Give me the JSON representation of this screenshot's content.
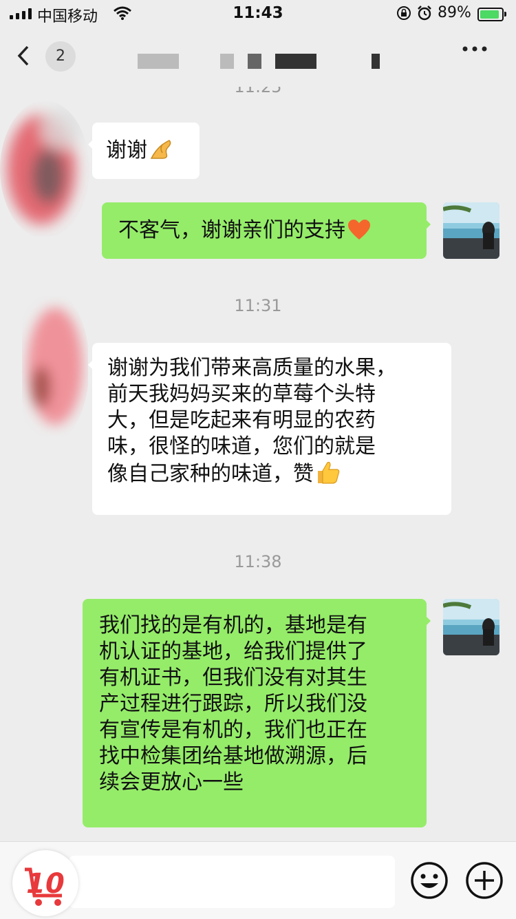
{
  "status_bar": {
    "carrier": "中国移动",
    "time": "11:43",
    "battery_percent": "89%"
  },
  "nav": {
    "back_icon": "chevron-left-icon",
    "unread_count": "2",
    "more_icon": "more-dots-icon"
  },
  "chat": {
    "partial_timestamp": "11:25",
    "msg1": {
      "text": "谢谢",
      "emoji": "ok-hand-emoji"
    },
    "msg2": {
      "text": "不客气，谢谢亲们的支持",
      "emoji": "orange-heart-emoji"
    },
    "timestamp2": "11:31",
    "msg3": {
      "lines": [
        "谢谢为我们带来高质量的水果，",
        "前天我妈妈买来的草莓个头特",
        "大，但是吃起来有明显的农药",
        "味，很怪的味道，您们的就是",
        "像自己家种的味道，赞"
      ],
      "emoji": "thumbs-up-emoji"
    },
    "timestamp3": "11:38",
    "msg4": {
      "lines": [
        "我们找的是有机的，基地是有",
        "机认证的基地，给我们提供了",
        "有机证书，但我们没有对其生",
        "产过程进行跟踪，所以我们没",
        "有宣传是有机的，我们也正在",
        "找中检集团给基地做溯源，后",
        "续会更放心一些"
      ]
    }
  },
  "input_bar": {
    "input_value": "",
    "logo_text": "10",
    "emoji_icon": "smiley-icon",
    "plus_icon": "plus-circle-icon"
  },
  "colors": {
    "outgoing_bubble": "#95ec69",
    "incoming_bubble": "#ffffff",
    "background": "#ededed"
  }
}
